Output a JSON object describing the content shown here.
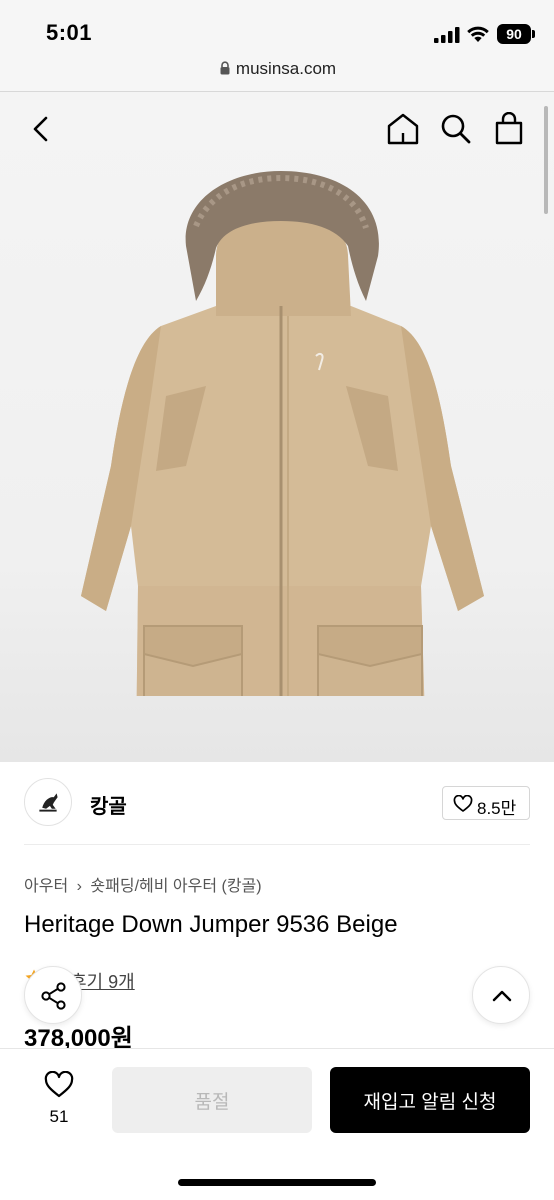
{
  "status_bar": {
    "time": "5:01",
    "battery": "90"
  },
  "browser": {
    "url": "musinsa.com"
  },
  "brand": {
    "name": "캉골",
    "likes": "8.5만"
  },
  "breadcrumb": {
    "category": "아우터",
    "subcategory": "숏패딩/헤비 아우터 (캉골)"
  },
  "product": {
    "title": "Heritage Down Jumper 9536 Beige",
    "review_link": "후기 9개",
    "price": "378,000원"
  },
  "bottom_bar": {
    "wish_count": "51",
    "soldout_label": "품절",
    "restock_label": "재입고 알림 신청"
  },
  "colors": {
    "jacket": "#d2b894",
    "fur": "#8a7866",
    "accent_star": "#f5a623"
  },
  "icons": [
    "back-icon",
    "home-icon",
    "search-icon",
    "cart-icon",
    "heart-icon",
    "share-icon",
    "chevron-up-icon",
    "star-icon",
    "lock-icon"
  ]
}
